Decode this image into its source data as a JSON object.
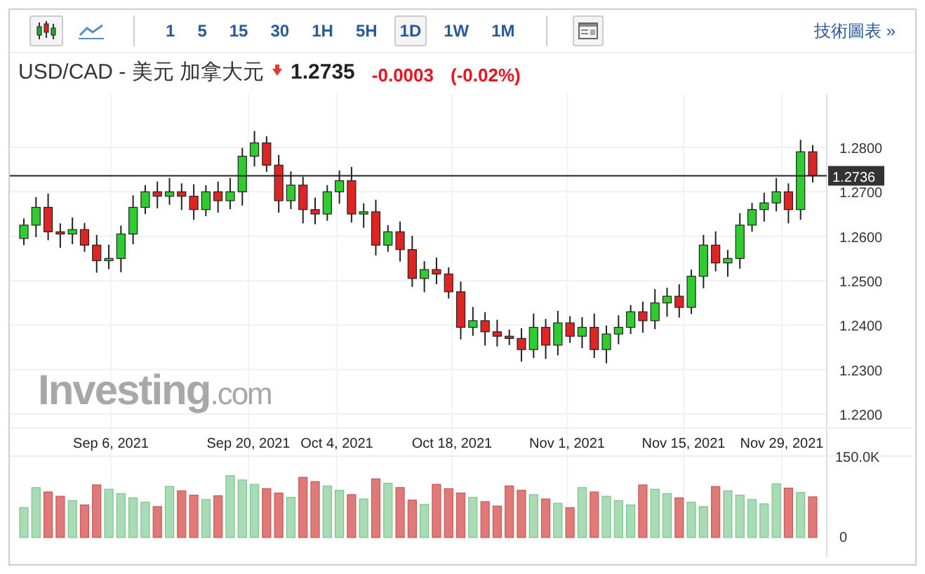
{
  "toolbar": {
    "chart_types": [
      {
        "kind": "candle",
        "selected": true
      },
      {
        "kind": "line",
        "selected": false
      }
    ],
    "intervals": [
      {
        "label": "1",
        "selected": false
      },
      {
        "label": "5",
        "selected": false
      },
      {
        "label": "15",
        "selected": false
      },
      {
        "label": "30",
        "selected": false
      },
      {
        "label": "1H",
        "selected": false
      },
      {
        "label": "5H",
        "selected": false
      },
      {
        "label": "1D",
        "selected": true
      },
      {
        "label": "1W",
        "selected": false
      },
      {
        "label": "1M",
        "selected": false
      }
    ],
    "link": "技術圖表 »"
  },
  "quote": {
    "symbol": "USD/CAD - 美元 加拿大元",
    "falling": true,
    "price": "1.2735",
    "change": "-0.0003",
    "change_percent": "(-0.02%)"
  },
  "chart": {
    "logo": {
      "name": "Investing",
      "suffix": ".com"
    },
    "current_price": "1.2736",
    "y_ticks": [
      "1.2800",
      "1.2700",
      "1.2600",
      "1.2500",
      "1.2400",
      "1.2300",
      "1.2200"
    ],
    "x_labels": [
      "Sep 6, 2021",
      "Sep 20, 2021",
      "Oct 4, 2021",
      "Oct 18, 2021",
      "Nov 1, 2021",
      "Nov 15, 2021",
      "Nov 29, 2021"
    ],
    "volume_ticks": [
      "150.0K",
      "0"
    ]
  }
}
